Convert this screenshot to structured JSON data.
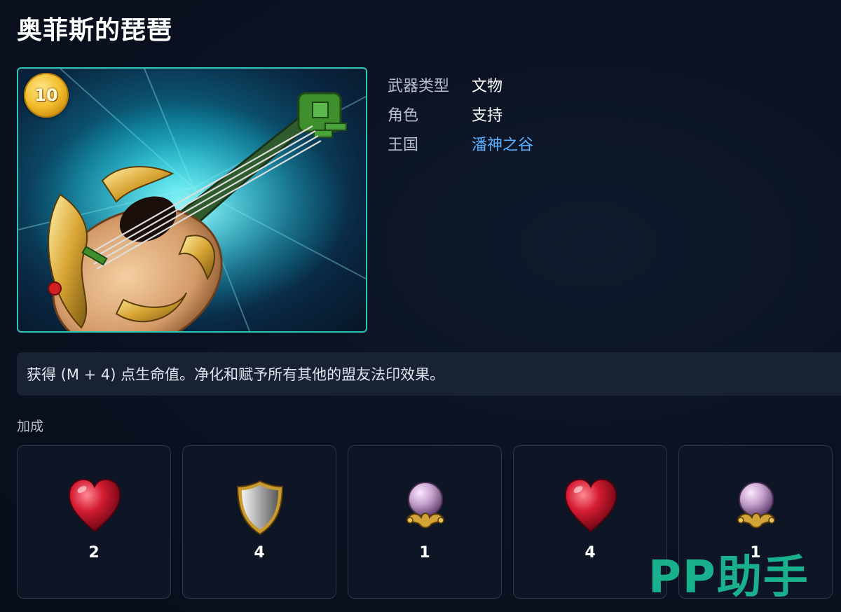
{
  "title": "奥菲斯的琵琶",
  "weapon": {
    "level": "10",
    "icon": "lute-weapon-image"
  },
  "attributes": [
    {
      "label": "武器类型",
      "value": "文物"
    },
    {
      "label": "角色",
      "value": "支持"
    },
    {
      "label": "王国",
      "value": "潘神之谷"
    }
  ],
  "description": "获得 (M + 4) 点生命值。净化和赋予所有其他的盟友法印效果。",
  "bonus": {
    "label": "加成",
    "items": [
      {
        "icon": "red-heart-icon",
        "count": "2"
      },
      {
        "icon": "silver-shield-icon",
        "count": "4"
      },
      {
        "icon": "magic-orb-icon",
        "count": "1"
      },
      {
        "icon": "red-heart-icon",
        "count": "4"
      },
      {
        "icon": "magic-orb-icon",
        "count": "1"
      }
    ]
  },
  "watermark": "PP助手",
  "colors": {
    "frame_border": "#2ec4b6",
    "link": "#5ab0ff",
    "watermark": "#1bbf96",
    "background": "#0b1220"
  }
}
